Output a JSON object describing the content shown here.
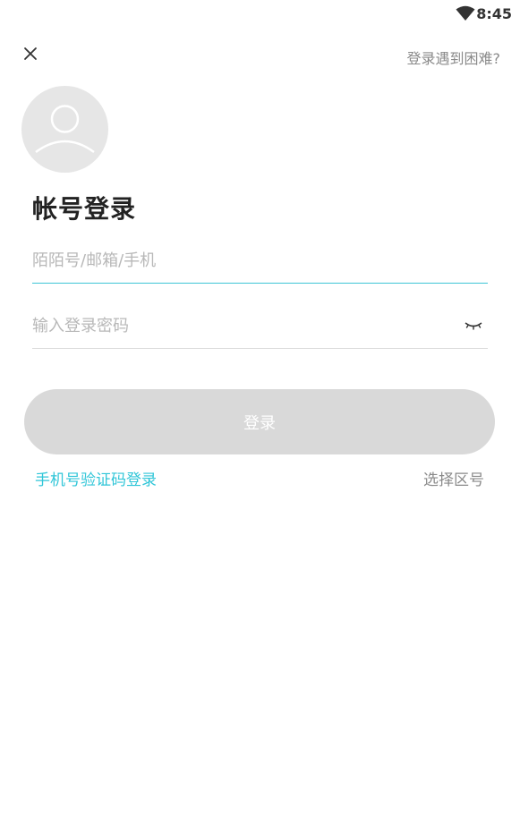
{
  "status_bar": {
    "time": "8:45",
    "wifi_icon": "wifi-icon"
  },
  "header": {
    "close_icon": "close-icon",
    "help_label": "登录遇到困难?"
  },
  "avatar": {
    "icon": "user-avatar-icon"
  },
  "title": "帐号登录",
  "account_field": {
    "placeholder": "陌陌号/邮箱/手机",
    "value": ""
  },
  "password_field": {
    "placeholder": "输入登录密码",
    "value": "",
    "toggle_icon": "eye-closed-icon"
  },
  "login_button": {
    "label": "登录"
  },
  "links": {
    "sms_login": "手机号验证码登录",
    "select_region": "选择区号"
  },
  "colors": {
    "accent": "#30c6d8",
    "button_disabled": "#d9d9d9",
    "muted_text": "#8a8a8a"
  }
}
